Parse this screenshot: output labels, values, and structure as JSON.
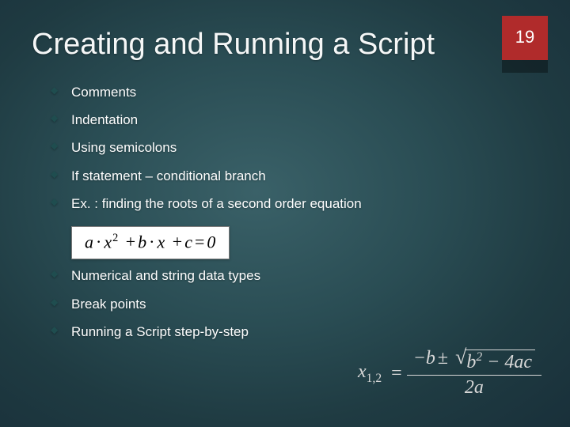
{
  "page_number": "19",
  "title": "Creating and Running a Script",
  "bullets": {
    "b0": "Comments",
    "b1": "Indentation",
    "b2": "Using semicolons",
    "b3": "If statement – conditional branch",
    "b4": "Ex. : finding the roots of a second order equation",
    "b5": "Numerical and string data types",
    "b6": "Break points",
    "b7": "Running a Script step-by-step"
  },
  "equation_box": "a · x² + b · x + c = 0",
  "quadratic_formula": "x_{1,2} = (-b ± √(b² − 4ac)) / (2a)"
}
